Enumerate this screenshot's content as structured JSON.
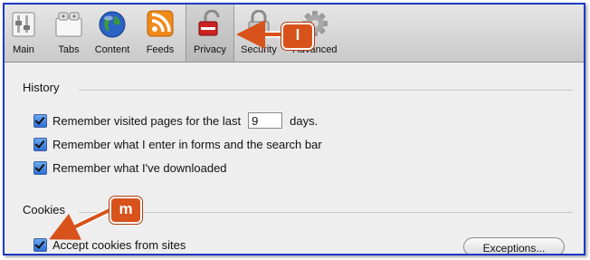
{
  "toolbar": {
    "tabs": [
      {
        "label": "Main",
        "icon": "switch-icon"
      },
      {
        "label": "Tabs",
        "icon": "tabs-icon"
      },
      {
        "label": "Content",
        "icon": "globe-icon"
      },
      {
        "label": "Feeds",
        "icon": "rss-icon"
      },
      {
        "label": "Privacy",
        "icon": "padlock-icon",
        "selected": true
      },
      {
        "label": "Security",
        "icon": "lock-icon"
      },
      {
        "label": "Advanced",
        "icon": "gear-icon"
      }
    ]
  },
  "history": {
    "title": "History",
    "remember_pages_prefix": "Remember visited pages for the last",
    "days_value": "9",
    "days_suffix": "days.",
    "remember_forms": "Remember what I enter in forms and the search bar",
    "remember_downloads": "Remember what I've downloaded"
  },
  "cookies": {
    "title": "Cookies",
    "accept_label": "Accept cookies from sites",
    "exceptions_label": "Exceptions..."
  },
  "annotations": {
    "callout_l": "l",
    "callout_m": "m",
    "color": "#d8521b"
  }
}
